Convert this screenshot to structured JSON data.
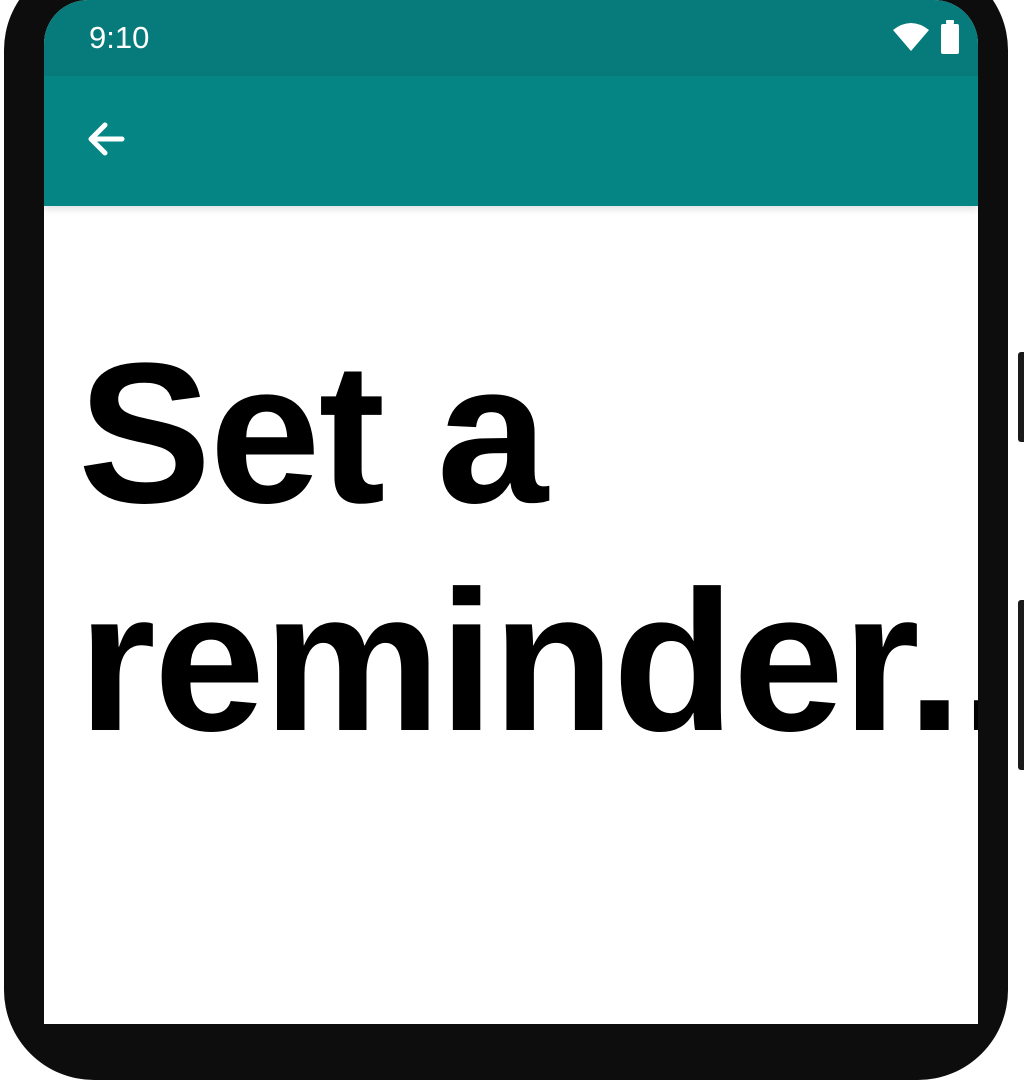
{
  "status_bar": {
    "time": "9:10",
    "icons": [
      "wifi-icon",
      "battery-icon"
    ]
  },
  "app_bar": {
    "back_icon": "arrow-left-icon"
  },
  "content": {
    "message": "Set a\nreminder.."
  },
  "colors": {
    "status_bar": "#077b7b",
    "app_bar": "#068585",
    "background": "#ffffff",
    "text": "#000000"
  }
}
